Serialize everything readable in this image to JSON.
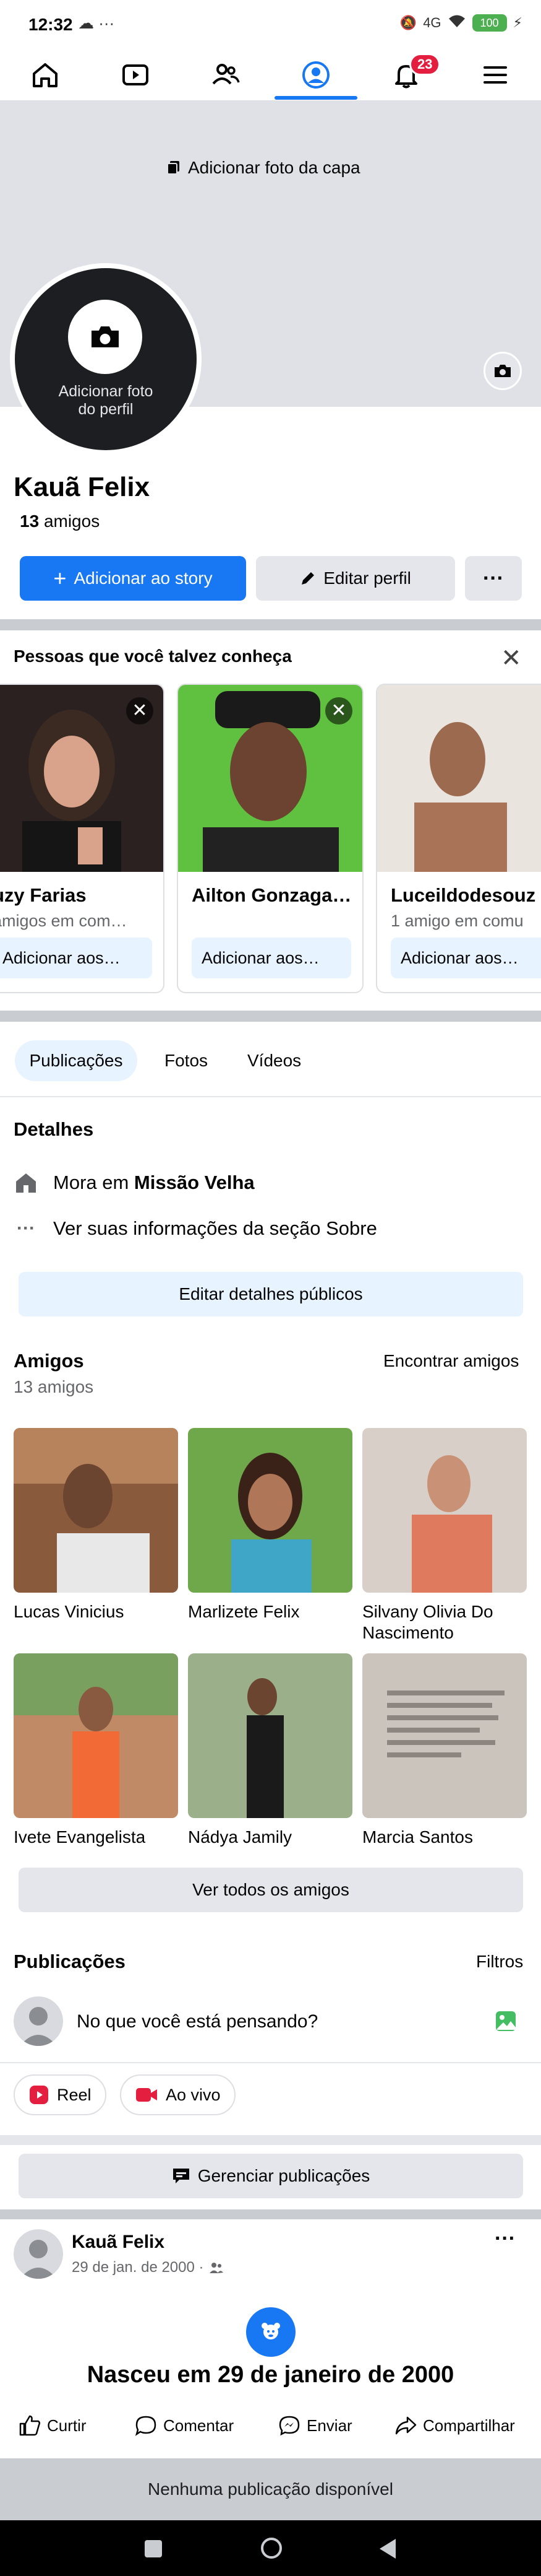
{
  "status_bar": {
    "time": "12:32",
    "left_icons": "☁ ···",
    "network": "4G",
    "battery": "100"
  },
  "nav": {
    "notifications_badge": "23"
  },
  "cover": {
    "add_cover_label": "Adicionar foto da capa"
  },
  "profile": {
    "add_photo_label_line1": "Adicionar foto",
    "add_photo_label_line2": "do perfil",
    "name": "Kauã Felix",
    "friends_number": "13",
    "friends_word": "amigos",
    "add_story_label": "Adicionar ao story",
    "edit_profile_label": "Editar perfil",
    "more_label": "···"
  },
  "pymk": {
    "title": "Pessoas que você talvez conheça",
    "cards": [
      {
        "name": "uzy Farias",
        "mutual": "amigos em com…",
        "button": "Adicionar aos…"
      },
      {
        "name": "Ailton Gonzaga…",
        "mutual": "",
        "button": "Adicionar aos…"
      },
      {
        "name": "Luceildodesouz",
        "mutual": "1 amigo em comu",
        "button": "Adicionar aos…"
      }
    ]
  },
  "tabs": {
    "posts": "Publicações",
    "photos": "Fotos",
    "videos": "Vídeos"
  },
  "details": {
    "title": "Detalhes",
    "lives_prefix": "Mora em ",
    "lives_city": "Missão Velha",
    "about_link": "Ver suas informações da seção Sobre",
    "edit_button": "Editar detalhes públicos"
  },
  "friends": {
    "title": "Amigos",
    "count_label": "13 amigos",
    "find_link": "Encontrar amigos",
    "items": [
      {
        "name": "Lucas Vinicius"
      },
      {
        "name": "Marlizete Felix"
      },
      {
        "name": "Silvany Olivia Do Nascimento"
      },
      {
        "name": "Ivete Evangelista"
      },
      {
        "name": "Nádya Jamily"
      },
      {
        "name": "Marcia Santos"
      }
    ],
    "see_all_button": "Ver todos os amigos"
  },
  "posts": {
    "title": "Publicações",
    "filters_link": "Filtros",
    "composer_placeholder": "No que você está pensando?",
    "reel_label": "Reel",
    "live_label": "Ao vivo",
    "manage_button": "Gerenciar publicações"
  },
  "life_event": {
    "author": "Kauã Felix",
    "date": "29 de jan. de 2000 ·",
    "headline": "Nasceu em 29 de janeiro de 2000",
    "actions": {
      "like": "Curtir",
      "comment": "Comentar",
      "send": "Enviar",
      "share": "Compartilhar"
    }
  },
  "footer": {
    "no_posts": "Nenhuma publicação disponível"
  },
  "colors": {
    "primary": "#1877f2",
    "badge": "#e41e3f",
    "cover_bg": "#dfe1e6",
    "divider": "#c9ccd1"
  }
}
